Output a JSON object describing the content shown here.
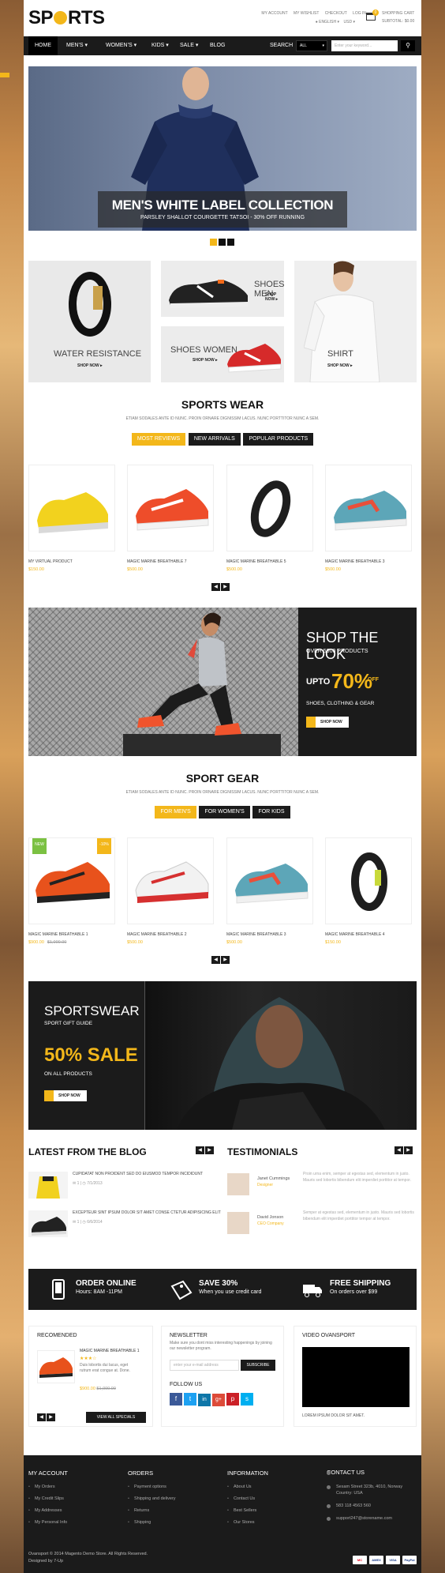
{
  "header": {
    "logo": "SPORTS",
    "links": [
      "MY ACCOUNT",
      "MY WISHLIST",
      "CHECKOUT",
      "LOG IN"
    ],
    "language": "ENGLISH",
    "currency": "USD",
    "cart_title": "SHOPPING CART",
    "cart_subtotal": "SUBTOTAL: $0.00",
    "cart_count": "0"
  },
  "nav": {
    "items": [
      "HOME",
      "MEN'S",
      "WOMEN'S",
      "KIDS",
      "SALE",
      "BLOG"
    ],
    "search_label": "SEARCH",
    "search_scope": "ALL",
    "search_placeholder": "Enter your keyword..."
  },
  "hero": {
    "title": "MEN'S WHITE LABEL COLLECTION",
    "subtitle": "PARSLEY SHALLOT COURGETTE TATSOI - 30% OFF RUNNING"
  },
  "banners": {
    "water": "WATER RESISTANCE",
    "shoes_men": "SHOES MEN",
    "shoes_women": "SHOES WOMEN",
    "shirt": "SHIRT",
    "shop_now": "SHOP NOW ▸"
  },
  "sports_wear": {
    "title": "SPORTS WEAR",
    "subtitle": "ETIAM SODALES ANTE ID NUNC. PROIN ORNARE DIGNISSIM LACUS. NUNC PORTTITOR NUNC A SEM.",
    "tabs": [
      "MOST REVIEWS",
      "NEW ARRIVALS",
      "POPULAR PRODUCTS"
    ],
    "products": [
      {
        "name": "MY VIRTUAL PRODUCT",
        "price": "$150.00"
      },
      {
        "name": "MAGIC MARINE BREATHABLE 7",
        "price": "$500.00"
      },
      {
        "name": "MAGIC MARINE BREATHABLE 5",
        "price": "$500.00"
      },
      {
        "name": "MAGIC MARINE BREATHABLE 3",
        "price": "$500.00"
      }
    ]
  },
  "look": {
    "title": "SHOP THE LOOK",
    "sub": "OVER 5000 PRODUCTS",
    "upto": "UPTO",
    "pct": "70%",
    "off": "OFF",
    "cats": "SHOES, CLOTHING & GEAR",
    "btn": "SHOP NOW"
  },
  "sport_gear": {
    "title": "SPORT GEAR",
    "subtitle": "ETIAM SODALES ANTE ID NUNC. PROIN ORNARE DIGNISSIM LACUS. NUNC PORTTITOR NUNC A SEM.",
    "tabs": [
      "FOR MEN'S",
      "FOR WOMEN'S",
      "FOR KIDS"
    ],
    "badge_new": "NEW",
    "badge_sale": "-10%",
    "products": [
      {
        "name": "MAGIC MARINE BREATHABLE 1",
        "price": "$900.00",
        "old": "$1,000.00"
      },
      {
        "name": "MAGIC MARINE BREATHABLE 2",
        "price": "$500.00",
        "old": ""
      },
      {
        "name": "MAGIC MARINE BREATHABLE 3",
        "price": "$500.00",
        "old": ""
      },
      {
        "name": "MAGIC MARINE BREATHABLE 4",
        "price": "$150.00",
        "old": ""
      }
    ]
  },
  "sportswear_banner": {
    "title": "SPORTSWEAR",
    "sub": "SPORT GIFT GUIDE",
    "sale": "50% SALE",
    "all": "ON ALL PRODUCTS",
    "btn": "SHOP NOW"
  },
  "blog": {
    "title": "LATEST FROM THE BLOG",
    "posts": [
      {
        "title": "CUPIDATAT NON PROIDENT SED DO EIUSMOD TEMPOR INCIDIDUNT",
        "meta": "✉ 1  |  ◷ 7/1/2013"
      },
      {
        "title": "EXCEPTEUR SINT IPSUM DOLOR SIT AMET CONSE CTETUR ADIPISICING ELIT",
        "meta": "✉ 1  |  ◷ 6/6/2014"
      }
    ]
  },
  "testimonials": {
    "title": "TESTIMONIALS",
    "items": [
      {
        "name": "Janet Cummings",
        "role": "Designer",
        "quote": "Proin urna enim, semper at egestas sed, elementum in justo. Mauris sed lobortis bibendum elit imperdiet porttitor at tempor."
      },
      {
        "name": "David Jonson",
        "role": "CEO Company",
        "quote": "Semper at egestas sed, elementum in justo. Mauris sed lobortis bibendum elit imperdiet porttitor tempor at tempor."
      }
    ]
  },
  "services": [
    {
      "title": "ORDER ONLINE",
      "sub": "Hours: 8AM -11PM"
    },
    {
      "title": "SAVE 30%",
      "sub": "When you use credit card"
    },
    {
      "title": "FREE SHIPPING",
      "sub": "On orders over $99"
    }
  ],
  "recommended": {
    "title": "RECOMENDED",
    "name": "MAGIC MARINE BREATHABLE 1",
    "desc": "Duis lobortis dui lacus, eget rutrum erat congue at. Done.",
    "price": "$900.00",
    "old": "$1,000.00",
    "btn": "VIEW ALL SPECIALS"
  },
  "newsletter": {
    "title": "NEWSLETTER",
    "text": "Make sure you dont miss interesting happenings by joining our newsletter program.",
    "placeholder": "enter your e-mail address",
    "btn": "SUBSCRIBE",
    "follow": "FOLLOW US"
  },
  "video": {
    "title": "VIDEO OVANSPORT",
    "caption": "LOREM IPSUM DOLOR SIT AMET."
  },
  "footer": {
    "account": {
      "title": "MY ACCOUNT",
      "links": [
        "My Orders",
        "My Credit Slips",
        "My Addresses",
        "My Personal Info"
      ]
    },
    "orders": {
      "title": "ORDERS",
      "links": [
        "Payment options",
        "Shipping and delivery",
        "Returns",
        "Shipping"
      ]
    },
    "information": {
      "title": "INFORMATION",
      "links": [
        "About Us",
        "Contact Us",
        "Best Sellers",
        "Our Stores"
      ]
    },
    "contact": {
      "title": "CONTACT US",
      "address": "Sesam Street 323b, 4010, Norway Country: USA",
      "phone": "583 118 4563 560",
      "email": "support247@storename.com"
    },
    "copyright": "Ovansport © 2014 Magento Demo Store. All Rights Reserved.",
    "designer": "Designed by 7-Up",
    "payments": [
      "MC",
      "AMEX",
      "VISA",
      "PayPal"
    ]
  },
  "colors": {
    "accent": "#f3b71a",
    "dark": "#1b1b1b"
  }
}
